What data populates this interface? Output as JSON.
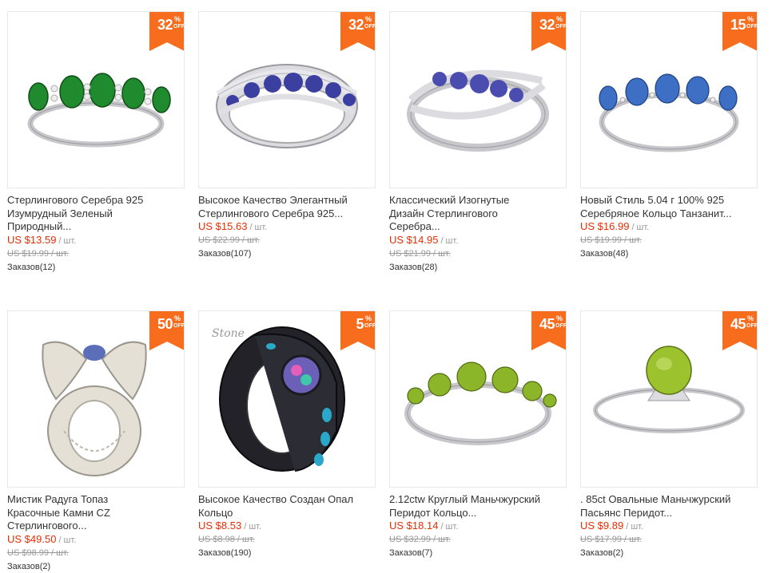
{
  "products": [
    {
      "title": "Стерлингового Серебра 925\nИзумрудный Зеленый\nПриродный...",
      "price": "US $13.59",
      "unit": "/ шт.",
      "old_price": "US $19.99 / шт.",
      "orders": "Заказов(12)",
      "discount": "32",
      "pct": "%",
      "off": "OFF",
      "gem_color": "#1f8a2e",
      "metal_color": "#c8c8cc"
    },
    {
      "title": "Высокое Качество Элегантный\nСтерлингового Серебра 925...",
      "price": "US $15.63",
      "unit": "/ шт.",
      "old_price": "US $22.99 / шт.",
      "orders": "Заказов(107)",
      "discount": "32",
      "pct": "%",
      "off": "OFF",
      "gem_color": "#3b3fa0",
      "metal_color": "#c8c8cc"
    },
    {
      "title": "Классический Изогнутые\nДизайн Стерлингового\nСеребра...",
      "price": "US $14.95",
      "unit": "/ шт.",
      "old_price": "US $21.99 / шт.",
      "orders": "Заказов(28)",
      "discount": "32",
      "pct": "%",
      "off": "OFF",
      "gem_color": "#4a4cb0",
      "metal_color": "#c8c8cc"
    },
    {
      "title": "Новый Стиль 5.04 г 100% 925\nСеребряное Кольцо Танзанит...",
      "price": "US $16.99",
      "unit": "/ шт.",
      "old_price": "US $19.99 / шт.",
      "orders": "Заказов(48)",
      "discount": "15",
      "pct": "%",
      "off": "OFF",
      "gem_color": "#3d6fc4",
      "metal_color": "#c8c8cc"
    },
    {
      "title": "Мистик Радуга Топаз\nКрасочные Камни CZ\nСтерлингового...",
      "price": "US $49.50",
      "unit": "/ шт.",
      "old_price": "US $98.99 / шт.",
      "orders": "Заказов(2)",
      "discount": "50",
      "pct": "%",
      "off": "OFF",
      "gem_color": "#5a6fb8",
      "metal_color": "#d8d4cc"
    },
    {
      "title": "Высокое Качество Создан Опал\nКольцо",
      "price": "US $8.53",
      "unit": "/ шт.",
      "old_price": "US $8.98 / шт.",
      "orders": "Заказов(190)",
      "discount": "5",
      "pct": "%",
      "off": "OFF",
      "gem_color": "#2aa8c9",
      "metal_color": "#222228",
      "watermark": "Stone"
    },
    {
      "title": "2.12ctw Круглый Маньчжурский\nПеридот Кольцо...",
      "price": "US $18.14",
      "unit": "/ шт.",
      "old_price": "US $32.99 / шт.",
      "orders": "Заказов(7)",
      "discount": "45",
      "pct": "%",
      "off": "OFF",
      "gem_color": "#8db52a",
      "metal_color": "#c8c8cc"
    },
    {
      "title": ". 85ct Овальные Маньчжурский\nПасьянс Перидот...",
      "price": "US $9.89",
      "unit": "/ шт.",
      "old_price": "US $17.99 / шт.",
      "orders": "Заказов(2)",
      "discount": "45",
      "pct": "%",
      "off": "OFF",
      "gem_color": "#9cc22e",
      "metal_color": "#c8c8cc"
    }
  ]
}
